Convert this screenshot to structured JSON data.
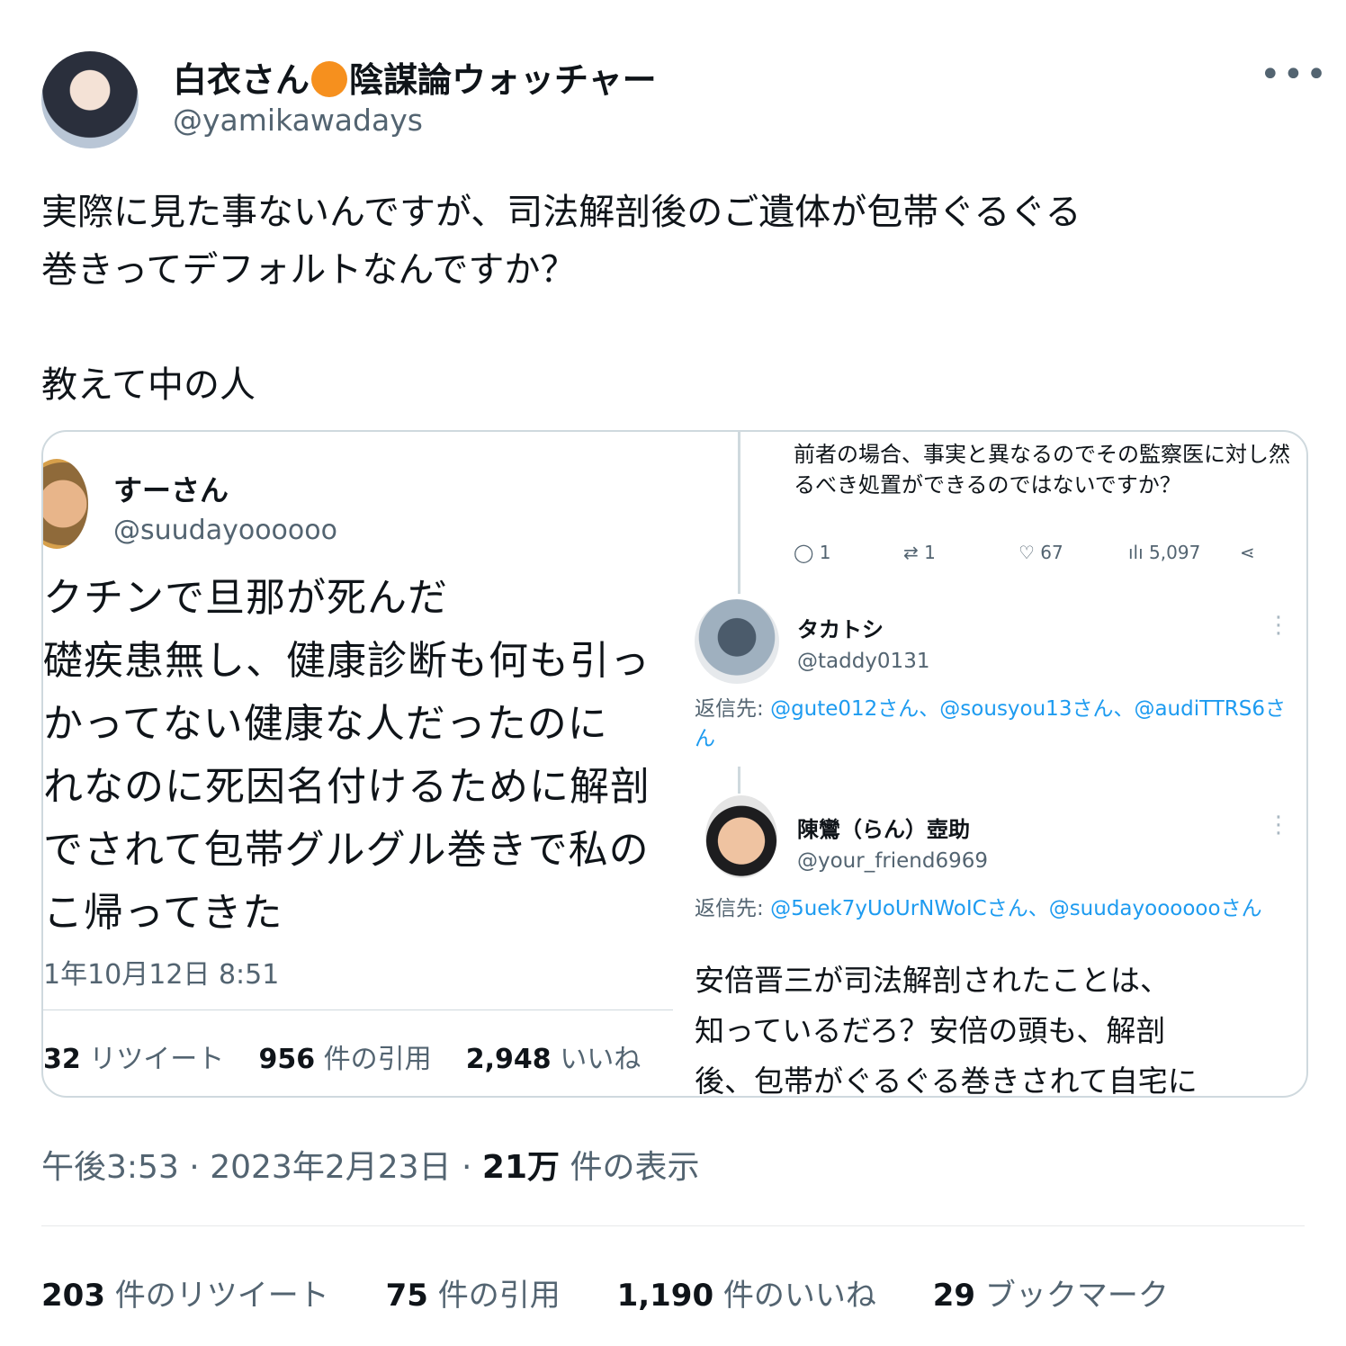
{
  "author": {
    "display_name_prefix": "白衣さん",
    "display_name_suffix": "陰謀論ウォッチャー",
    "handle": "@yamikawadays",
    "badge_color": "#f6901e"
  },
  "menu_icon": "more-horizontal-icon",
  "tweet_text": "実際に見た事ないんですが、司法解剖後のご遺体が包帯ぐるぐる\n巻きってデフォルトなんですか？\n\n教えて中の人",
  "embedded_left": {
    "name": "すーさん",
    "handle": "@suudayoooooo",
    "text": "クチンで旦那が死んだ\n礎疾患無し、健康診断も何も引っ\nかってない健康な人だったのに\nれなのに死因名付けるために解剖\nでされて包帯グルグル巻きで私の\nこ帰ってきた",
    "timestamp": "1年10月12日 8:51",
    "retweets_value": "32",
    "retweets_label": "リツイート",
    "quotes_value": "956",
    "quotes_label": "件の引用",
    "likes_value": "2,948",
    "likes_label": "いいね"
  },
  "embedded_right": {
    "reply_text": "前者の場合、事実と異なるのでその監察医に対し然るべき処置ができるのではないですか？",
    "actions": {
      "replies": "1",
      "retweets": "1",
      "likes": "67",
      "views": "5,097"
    },
    "reply1": {
      "name": "タカトシ",
      "handle": "@taddy0131",
      "reply_prefix": "返信先: ",
      "reply_to": "@gute012さん、@sousyou13さん、@audiTTRS6さん"
    },
    "reply2": {
      "name": "陳鸞（らん）壺助",
      "handle": "@your_friend6969",
      "reply_prefix": "返信先: ",
      "reply_to": "@5uek7yUoUrNWoICさん、@suudayooooooさん",
      "text": "安倍晋三が司法解剖されたことは、\n知っているだろ？安倍の頭も、解剖\n後、包帯がぐるぐる巻きされて自宅に"
    }
  },
  "meta": {
    "time": "午後3:53",
    "sep": "·",
    "date": "2023年2月23日",
    "views_value": "21万",
    "views_label": "件の表示"
  },
  "stats": {
    "retweets_value": "203",
    "retweets_label": "件のリツイート",
    "quotes_value": "75",
    "quotes_label": "件の引用",
    "likes_value": "1,190",
    "likes_label": "件のいいね",
    "bookmarks_value": "29",
    "bookmarks_label": "ブックマーク"
  }
}
